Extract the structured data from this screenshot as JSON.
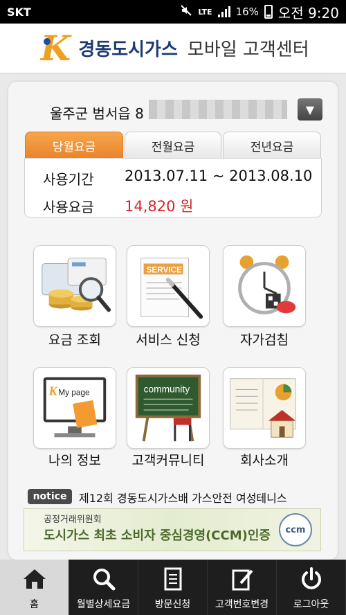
{
  "status_bar": {
    "carrier": "SKT",
    "network": "LTE",
    "battery": "16%",
    "time": "오전 9:20"
  },
  "header": {
    "logo_letter": "K",
    "brand": "경동도시가스",
    "subtitle": "모바일 고객센터"
  },
  "address": {
    "value": "울주군 범서읍 8"
  },
  "tabs": [
    {
      "label": "당월요금",
      "active": true
    },
    {
      "label": "전월요금",
      "active": false
    },
    {
      "label": "전년요금",
      "active": false
    }
  ],
  "usage": {
    "period_label": "사용기간",
    "period_value": "2013.07.11 ~ 2013.08.10",
    "amount_label": "사용요금",
    "amount_value": "14,820 원"
  },
  "menu": [
    {
      "label": "요금 조회",
      "icon": "coins-magnifier-icon"
    },
    {
      "label": "서비스 신청",
      "icon": "service-document-icon",
      "icon_text": "SERVICE"
    },
    {
      "label": "자가검침",
      "icon": "alarm-clock-icon"
    },
    {
      "label": "나의 정보",
      "icon": "mypage-monitor-icon",
      "icon_text": "My page"
    },
    {
      "label": "고객커뮤니티",
      "icon": "community-board-icon",
      "icon_text": "community"
    },
    {
      "label": "회사소개",
      "icon": "house-book-icon"
    }
  ],
  "notice": {
    "badge": "notice",
    "text": "제12회 경동도시가스배 가스안전 여성테니스"
  },
  "banner": {
    "line1": "공정거래위원회",
    "line2": "도시가스 최초 소비자 중심경영(CCM)인증",
    "badge": "ccm"
  },
  "bottom_nav": [
    {
      "label": "홈",
      "icon": "home-icon",
      "active": true
    },
    {
      "label": "월별상세요금",
      "icon": "search-icon",
      "active": false
    },
    {
      "label": "방문신청",
      "icon": "document-icon",
      "active": false
    },
    {
      "label": "고객번호변경",
      "icon": "edit-icon",
      "active": false
    },
    {
      "label": "로그아웃",
      "icon": "power-icon",
      "active": false
    }
  ],
  "colors": {
    "accent_orange": "#e8832a",
    "brand_blue": "#1a3a73",
    "amount_red": "#d8232a"
  }
}
